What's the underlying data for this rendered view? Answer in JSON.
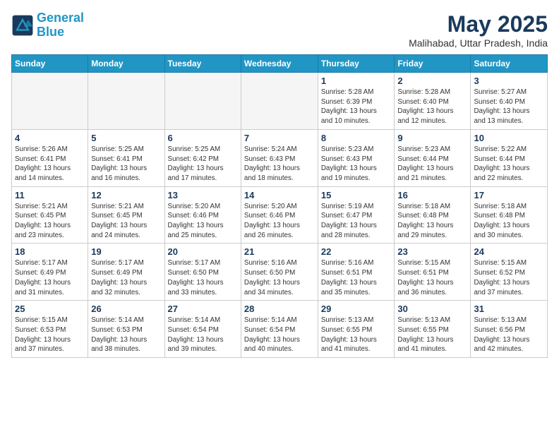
{
  "logo": {
    "line1": "General",
    "line2": "Blue"
  },
  "title": "May 2025",
  "subtitle": "Malihabad, Uttar Pradesh, India",
  "weekdays": [
    "Sunday",
    "Monday",
    "Tuesday",
    "Wednesday",
    "Thursday",
    "Friday",
    "Saturday"
  ],
  "weeks": [
    [
      {
        "day": "",
        "info": ""
      },
      {
        "day": "",
        "info": ""
      },
      {
        "day": "",
        "info": ""
      },
      {
        "day": "",
        "info": ""
      },
      {
        "day": "1",
        "info": "Sunrise: 5:28 AM\nSunset: 6:39 PM\nDaylight: 13 hours\nand 10 minutes."
      },
      {
        "day": "2",
        "info": "Sunrise: 5:28 AM\nSunset: 6:40 PM\nDaylight: 13 hours\nand 12 minutes."
      },
      {
        "day": "3",
        "info": "Sunrise: 5:27 AM\nSunset: 6:40 PM\nDaylight: 13 hours\nand 13 minutes."
      }
    ],
    [
      {
        "day": "4",
        "info": "Sunrise: 5:26 AM\nSunset: 6:41 PM\nDaylight: 13 hours\nand 14 minutes."
      },
      {
        "day": "5",
        "info": "Sunrise: 5:25 AM\nSunset: 6:41 PM\nDaylight: 13 hours\nand 16 minutes."
      },
      {
        "day": "6",
        "info": "Sunrise: 5:25 AM\nSunset: 6:42 PM\nDaylight: 13 hours\nand 17 minutes."
      },
      {
        "day": "7",
        "info": "Sunrise: 5:24 AM\nSunset: 6:43 PM\nDaylight: 13 hours\nand 18 minutes."
      },
      {
        "day": "8",
        "info": "Sunrise: 5:23 AM\nSunset: 6:43 PM\nDaylight: 13 hours\nand 19 minutes."
      },
      {
        "day": "9",
        "info": "Sunrise: 5:23 AM\nSunset: 6:44 PM\nDaylight: 13 hours\nand 21 minutes."
      },
      {
        "day": "10",
        "info": "Sunrise: 5:22 AM\nSunset: 6:44 PM\nDaylight: 13 hours\nand 22 minutes."
      }
    ],
    [
      {
        "day": "11",
        "info": "Sunrise: 5:21 AM\nSunset: 6:45 PM\nDaylight: 13 hours\nand 23 minutes."
      },
      {
        "day": "12",
        "info": "Sunrise: 5:21 AM\nSunset: 6:45 PM\nDaylight: 13 hours\nand 24 minutes."
      },
      {
        "day": "13",
        "info": "Sunrise: 5:20 AM\nSunset: 6:46 PM\nDaylight: 13 hours\nand 25 minutes."
      },
      {
        "day": "14",
        "info": "Sunrise: 5:20 AM\nSunset: 6:46 PM\nDaylight: 13 hours\nand 26 minutes."
      },
      {
        "day": "15",
        "info": "Sunrise: 5:19 AM\nSunset: 6:47 PM\nDaylight: 13 hours\nand 28 minutes."
      },
      {
        "day": "16",
        "info": "Sunrise: 5:18 AM\nSunset: 6:48 PM\nDaylight: 13 hours\nand 29 minutes."
      },
      {
        "day": "17",
        "info": "Sunrise: 5:18 AM\nSunset: 6:48 PM\nDaylight: 13 hours\nand 30 minutes."
      }
    ],
    [
      {
        "day": "18",
        "info": "Sunrise: 5:17 AM\nSunset: 6:49 PM\nDaylight: 13 hours\nand 31 minutes."
      },
      {
        "day": "19",
        "info": "Sunrise: 5:17 AM\nSunset: 6:49 PM\nDaylight: 13 hours\nand 32 minutes."
      },
      {
        "day": "20",
        "info": "Sunrise: 5:17 AM\nSunset: 6:50 PM\nDaylight: 13 hours\nand 33 minutes."
      },
      {
        "day": "21",
        "info": "Sunrise: 5:16 AM\nSunset: 6:50 PM\nDaylight: 13 hours\nand 34 minutes."
      },
      {
        "day": "22",
        "info": "Sunrise: 5:16 AM\nSunset: 6:51 PM\nDaylight: 13 hours\nand 35 minutes."
      },
      {
        "day": "23",
        "info": "Sunrise: 5:15 AM\nSunset: 6:51 PM\nDaylight: 13 hours\nand 36 minutes."
      },
      {
        "day": "24",
        "info": "Sunrise: 5:15 AM\nSunset: 6:52 PM\nDaylight: 13 hours\nand 37 minutes."
      }
    ],
    [
      {
        "day": "25",
        "info": "Sunrise: 5:15 AM\nSunset: 6:53 PM\nDaylight: 13 hours\nand 37 minutes."
      },
      {
        "day": "26",
        "info": "Sunrise: 5:14 AM\nSunset: 6:53 PM\nDaylight: 13 hours\nand 38 minutes."
      },
      {
        "day": "27",
        "info": "Sunrise: 5:14 AM\nSunset: 6:54 PM\nDaylight: 13 hours\nand 39 minutes."
      },
      {
        "day": "28",
        "info": "Sunrise: 5:14 AM\nSunset: 6:54 PM\nDaylight: 13 hours\nand 40 minutes."
      },
      {
        "day": "29",
        "info": "Sunrise: 5:13 AM\nSunset: 6:55 PM\nDaylight: 13 hours\nand 41 minutes."
      },
      {
        "day": "30",
        "info": "Sunrise: 5:13 AM\nSunset: 6:55 PM\nDaylight: 13 hours\nand 41 minutes."
      },
      {
        "day": "31",
        "info": "Sunrise: 5:13 AM\nSunset: 6:56 PM\nDaylight: 13 hours\nand 42 minutes."
      }
    ]
  ]
}
